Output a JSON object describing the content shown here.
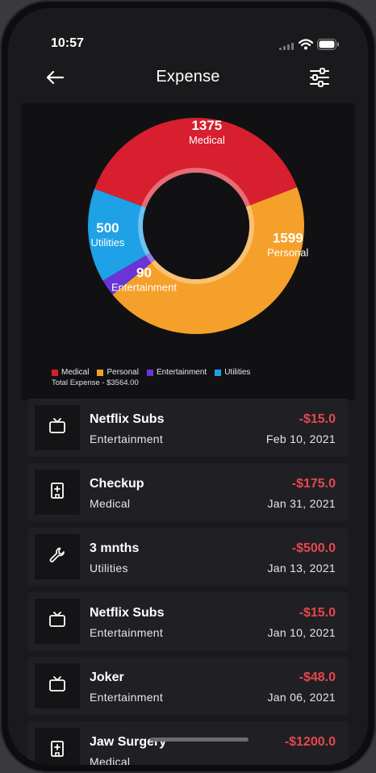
{
  "status": {
    "time": "10:57"
  },
  "header": {
    "title": "Expense"
  },
  "colors": {
    "medical": "#d81f2f",
    "personal": "#f5a02a",
    "entertainment": "#6a34d6",
    "utilities": "#1ea1e6",
    "negative": "#e5484d"
  },
  "chart_data": {
    "type": "pie",
    "donut": true,
    "categories": [
      "Medical",
      "Personal",
      "Entertainment",
      "Utilities"
    ],
    "values": [
      1375,
      1599,
      90,
      500
    ],
    "value_labels": [
      "1375",
      "1599",
      "90",
      "500"
    ],
    "legend_placement": "bottom-left",
    "total_label": "Total Expense - $3564.00"
  },
  "transactions": [
    {
      "name": "Netflix Subs",
      "category": "Entertainment",
      "amount": "-$15.0",
      "date": "Feb 10, 2021",
      "icon": "tv-icon"
    },
    {
      "name": "Checkup",
      "category": "Medical",
      "amount": "-$175.0",
      "date": "Jan 31, 2021",
      "icon": "hospital-icon"
    },
    {
      "name": "3 mnths",
      "category": "Utilities",
      "amount": "-$500.0",
      "date": "Jan 13, 2021",
      "icon": "wrench-icon"
    },
    {
      "name": "Netflix Subs",
      "category": "Entertainment",
      "amount": "-$15.0",
      "date": "Jan 10, 2021",
      "icon": "tv-icon"
    },
    {
      "name": "Joker",
      "category": "Entertainment",
      "amount": "-$48.0",
      "date": "Jan 06, 2021",
      "icon": "tv-icon"
    },
    {
      "name": "Jaw Surgery",
      "category": "Medical",
      "amount": "-$1200.0",
      "date": "",
      "icon": "hospital-icon"
    }
  ]
}
